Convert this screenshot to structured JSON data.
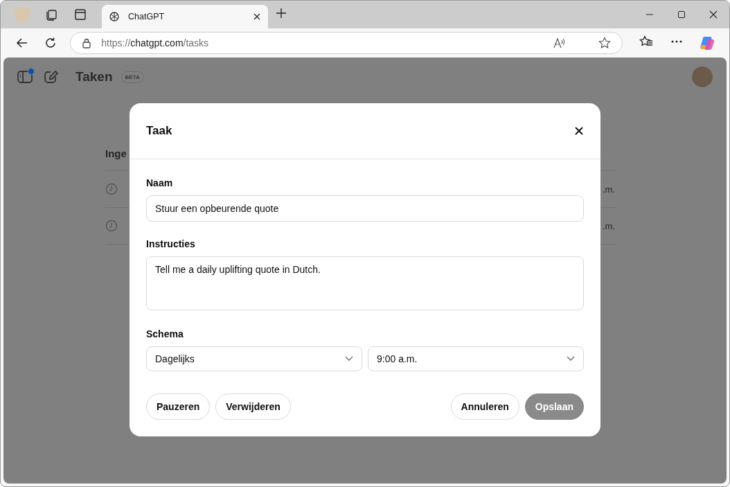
{
  "browser": {
    "tab": {
      "title": "ChatGPT",
      "selected": true
    },
    "url": {
      "scheme": "https://",
      "host": "chatgpt.com",
      "path": "/tasks"
    }
  },
  "page": {
    "title": "Taken",
    "badge": "BÈTA",
    "sidebar_notification": true,
    "section_heading": "Inge",
    "tasks": [
      {
        "time": ".m."
      },
      {
        "time": ".m."
      }
    ]
  },
  "dialog": {
    "title": "Taak",
    "fields": [
      {
        "label": "Naam",
        "kind": "text",
        "value": "Stuur een opbeurende quote"
      },
      {
        "label": "Instructies",
        "kind": "textarea",
        "value": "Tell me a daily uplifting quote in Dutch."
      }
    ],
    "schedule": {
      "label": "Schema",
      "frequency": "Dagelijks",
      "time": "9:00 a.m."
    },
    "buttons_left": [
      {
        "label": "Pauzeren",
        "kind": "secondary"
      },
      {
        "label": "Verwijderen",
        "kind": "secondary"
      }
    ],
    "buttons_right": [
      {
        "label": "Annuleren",
        "kind": "secondary"
      },
      {
        "label": "Opslaan",
        "kind": "primary"
      }
    ]
  }
}
